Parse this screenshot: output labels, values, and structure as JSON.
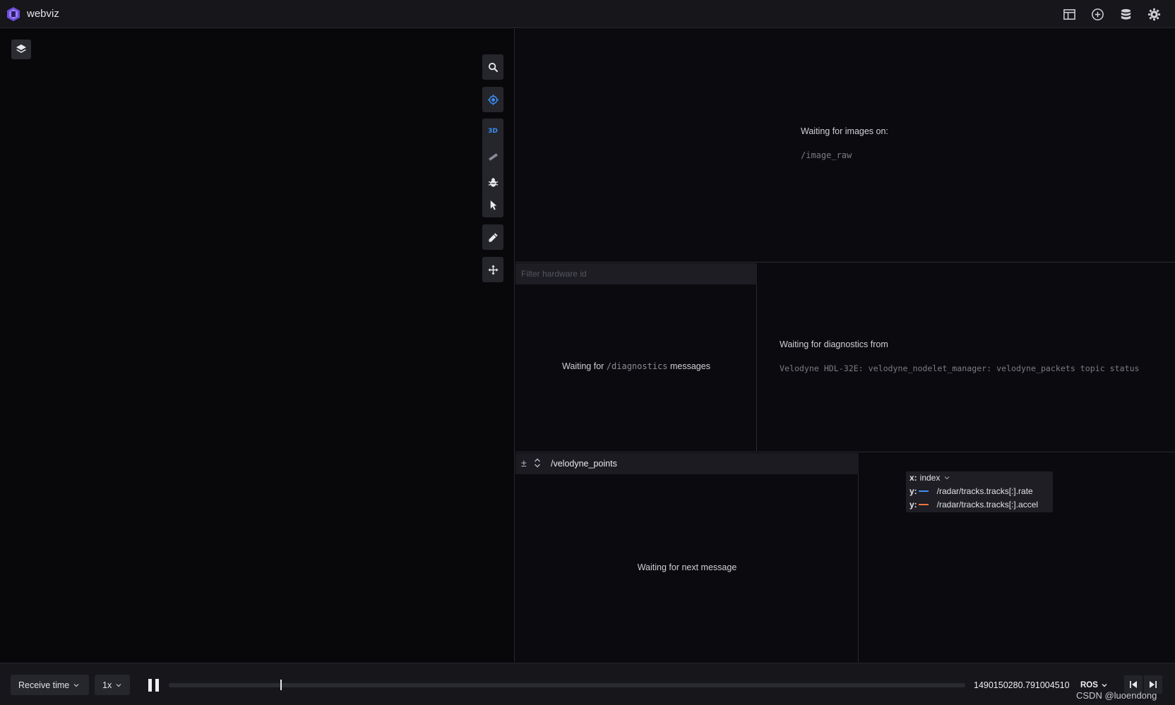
{
  "app": {
    "title": "webviz"
  },
  "colors": {
    "accent": "#3b8ff5",
    "series_rate": "#3b8ff5",
    "series_accel": "#f5733b",
    "background": "#08080b"
  },
  "header_icons": [
    "layout-icon",
    "add-panel-icon",
    "data-source-icon",
    "settings-icon"
  ],
  "scene3d": {
    "tools": [
      "search-icon",
      "follow-target-icon",
      "3d-toggle",
      "measure-icon",
      "debug-icon",
      "select-icon",
      "draw-icon",
      "move-icon"
    ],
    "view_mode_label": "3D"
  },
  "image_panel": {
    "waiting_text": "Waiting for images on:",
    "topic": "/image_raw"
  },
  "diagnostics_summary": {
    "filter_placeholder": "Filter hardware id",
    "waiting_prefix": "Waiting for",
    "waiting_topic": "/diagnostics",
    "waiting_suffix": "messages"
  },
  "diagnostics_detail": {
    "waiting_text": "Waiting for diagnostics from",
    "source": "Velodyne HDL-32E: velodyne_nodelet_manager: velodyne_packets topic status"
  },
  "raw_messages": {
    "expand_symbol": "±",
    "topic": "/velodyne_points",
    "waiting_text": "Waiting for next message"
  },
  "plot": {
    "x_prefix": "x:",
    "x_axis": "index",
    "y_prefix": "y:",
    "series": [
      {
        "path": "/radar/tracks.tracks[:].rate",
        "color": "#3b8ff5"
      },
      {
        "path": "/radar/tracks.tracks[:].accel",
        "color": "#f5733b"
      }
    ]
  },
  "playback": {
    "time_mode": "Receive time",
    "speed": "1x",
    "progress": 0.14,
    "timestamp": "1490150280.791004510",
    "time_format": "ROS",
    "watermark": "CSDN @luoendong"
  }
}
